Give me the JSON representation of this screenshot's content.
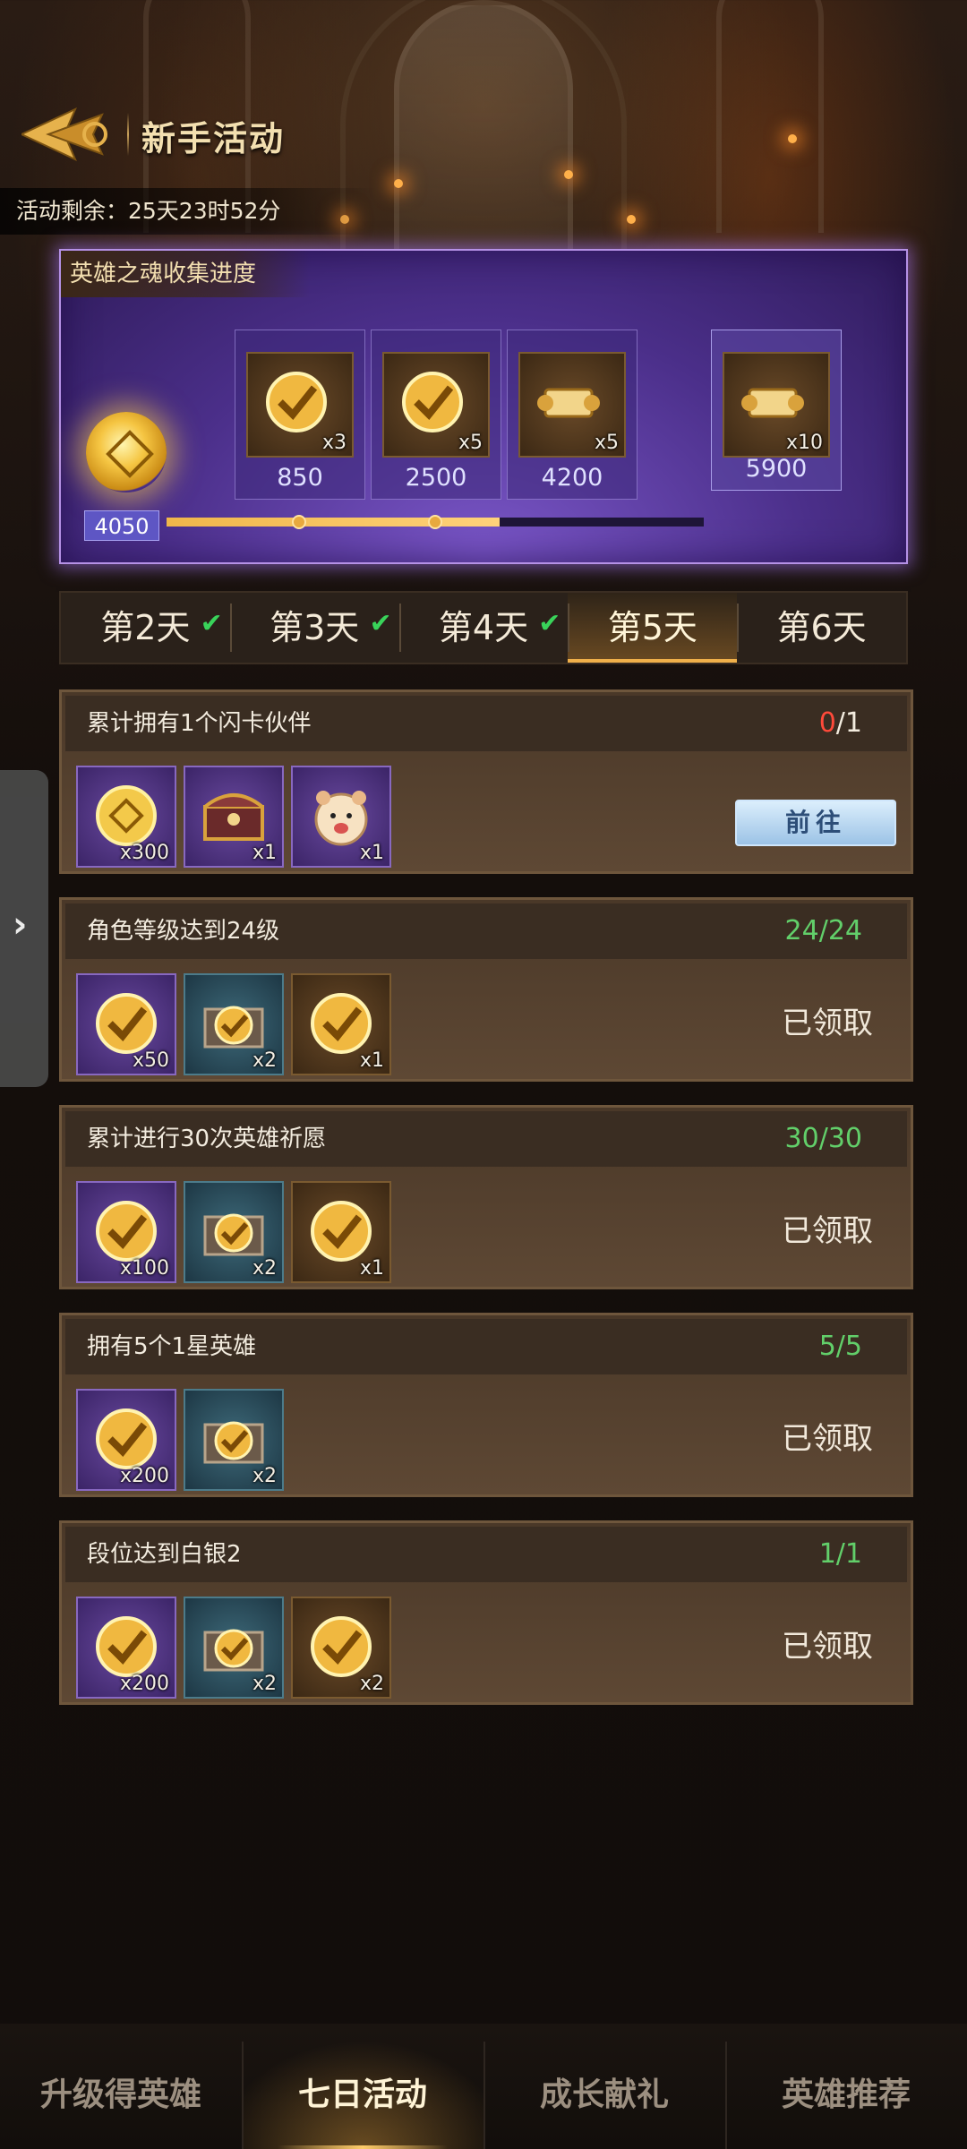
{
  "header": {
    "title": "新手活动",
    "timer": "活动剩余：25天23时52分"
  },
  "progress": {
    "title": "英雄之魂收集进度",
    "current": "4050",
    "fraction_complete": 0.62,
    "milestones": [
      {
        "value": "850",
        "qty": "x3",
        "icon": "gold-check-token-icon"
      },
      {
        "value": "2500",
        "qty": "x5",
        "icon": "gold-check-token-icon"
      },
      {
        "value": "4200",
        "qty": "x5",
        "icon": "scroll-icon"
      },
      {
        "value": "5900",
        "qty": "x10",
        "icon": "scroll-icon"
      }
    ]
  },
  "tabs": [
    {
      "label": "第2天",
      "done": true
    },
    {
      "label": "第3天",
      "done": true
    },
    {
      "label": "第4天",
      "done": true
    },
    {
      "label": "第5天",
      "done": false,
      "active": true
    },
    {
      "label": "第6天",
      "done": false
    }
  ],
  "tasks": [
    {
      "title": "累计拥有1个闪卡伙伴",
      "progress_current": "0",
      "progress_sep_total": "/1",
      "status": "",
      "button": "前往",
      "rewards": [
        {
          "icon": "hero-soul-icon",
          "qty": "x300",
          "bg": "purple"
        },
        {
          "icon": "treasure-chest-icon",
          "qty": "x1",
          "bg": "purple"
        },
        {
          "icon": "hamster-avatar-icon",
          "qty": "x1",
          "bg": "purple"
        }
      ]
    },
    {
      "title": "角色等级达到24级",
      "progress_current": "24",
      "progress_sep_total": "/24",
      "status": "已领取",
      "rewards": [
        {
          "icon": "gold-check-token-icon",
          "qty": "x50",
          "bg": "purple"
        },
        {
          "icon": "check-chest-icon",
          "qty": "x2",
          "bg": "blue"
        },
        {
          "icon": "gold-check-token-icon",
          "qty": "x1",
          "bg": "brown"
        }
      ]
    },
    {
      "title": "累计进行30次英雄祈愿",
      "progress_current": "30",
      "progress_sep_total": "/30",
      "status": "已领取",
      "rewards": [
        {
          "icon": "gold-check-token-icon",
          "qty": "x100",
          "bg": "purple"
        },
        {
          "icon": "check-chest-icon",
          "qty": "x2",
          "bg": "blue"
        },
        {
          "icon": "gold-check-token-icon",
          "qty": "x1",
          "bg": "brown"
        }
      ]
    },
    {
      "title": "拥有5个1星英雄",
      "progress_current": "5",
      "progress_sep_total": "/5",
      "status": "已领取",
      "rewards": [
        {
          "icon": "gold-check-token-icon",
          "qty": "x200",
          "bg": "purple"
        },
        {
          "icon": "check-chest-icon",
          "qty": "x2",
          "bg": "blue"
        }
      ]
    },
    {
      "title": "段位达到白银2",
      "progress_current": "1",
      "progress_sep_total": "/1",
      "status": "已领取",
      "rewards": [
        {
          "icon": "gold-check-token-icon",
          "qty": "x200",
          "bg": "purple"
        },
        {
          "icon": "check-chest-icon",
          "qty": "x2",
          "bg": "blue"
        },
        {
          "icon": "gold-check-token-icon",
          "qty": "x2",
          "bg": "brown"
        }
      ]
    }
  ],
  "side_handle": {
    "icon": "chevron-right-icon",
    "glyph": "›"
  },
  "bottom_nav": [
    {
      "label": "升级得英雄"
    },
    {
      "label": "七日活动",
      "active": true
    },
    {
      "label": "成长献礼"
    },
    {
      "label": "英雄推荐"
    }
  ],
  "colors": {
    "accent_gold": "#f0b64a",
    "complete_green": "#62cf6a",
    "incomplete_red": "#ff4a3a",
    "panel_purple": "#4b2f8a"
  }
}
